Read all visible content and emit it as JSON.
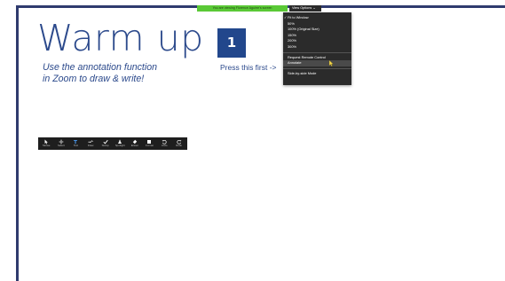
{
  "banner": {
    "text": "You are viewing Florence Aguirre's screen",
    "color": "#5ac936"
  },
  "view_options": {
    "label": "View Options ⌄",
    "items": [
      {
        "label": "Fit to Window",
        "checked": true
      },
      {
        "label": "50%"
      },
      {
        "label": "100% (Original Size)"
      },
      {
        "label": "150%"
      },
      {
        "label": "200%"
      },
      {
        "label": "300%"
      }
    ],
    "remote_control": "Request Remote Control",
    "annotate": "Annotate",
    "side_by_side": "Side-by-side Mode"
  },
  "slide": {
    "title": "Warm up",
    "subtitle_line1": "Use the annotation function",
    "subtitle_line2": "in Zoom to draw & write!",
    "number": "1",
    "press_label": "Press this first ->",
    "accent_color": "#2c4a8c",
    "box_color": "#22478c"
  },
  "toolbar": {
    "tools": [
      {
        "label": "Mouse",
        "icon": "cursor-icon"
      },
      {
        "label": "Select",
        "icon": "move-icon"
      },
      {
        "label": "Text",
        "icon": "text-icon"
      },
      {
        "label": "Draw",
        "icon": "squiggle-icon"
      },
      {
        "label": "Stamp",
        "icon": "checkmark-icon"
      },
      {
        "label": "Spotlight",
        "icon": "spotlight-icon"
      },
      {
        "label": "Eraser",
        "icon": "eraser-icon"
      },
      {
        "label": "Format",
        "icon": "format-icon"
      },
      {
        "label": "Undo",
        "icon": "undo-icon"
      },
      {
        "label": "Redo",
        "icon": "redo-icon"
      }
    ]
  }
}
